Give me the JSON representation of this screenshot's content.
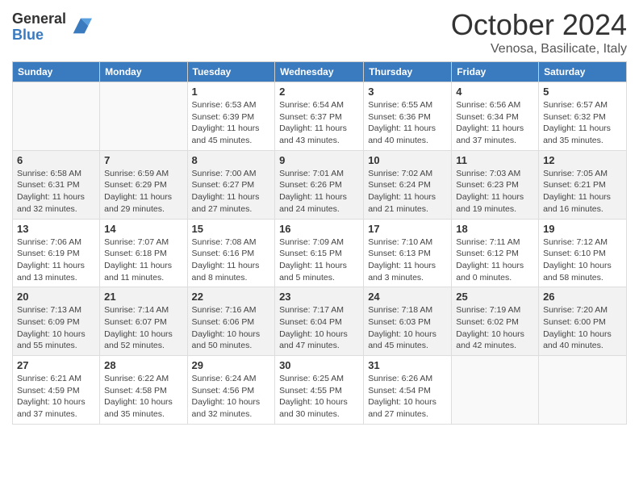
{
  "header": {
    "logo_general": "General",
    "logo_blue": "Blue",
    "title": "October 2024",
    "subtitle": "Venosa, Basilicate, Italy"
  },
  "weekdays": [
    "Sunday",
    "Monday",
    "Tuesday",
    "Wednesday",
    "Thursday",
    "Friday",
    "Saturday"
  ],
  "weeks": [
    [
      {
        "day": "",
        "sunrise": "",
        "sunset": "",
        "daylight": ""
      },
      {
        "day": "",
        "sunrise": "",
        "sunset": "",
        "daylight": ""
      },
      {
        "day": "1",
        "sunrise": "Sunrise: 6:53 AM",
        "sunset": "Sunset: 6:39 PM",
        "daylight": "Daylight: 11 hours and 45 minutes."
      },
      {
        "day": "2",
        "sunrise": "Sunrise: 6:54 AM",
        "sunset": "Sunset: 6:37 PM",
        "daylight": "Daylight: 11 hours and 43 minutes."
      },
      {
        "day": "3",
        "sunrise": "Sunrise: 6:55 AM",
        "sunset": "Sunset: 6:36 PM",
        "daylight": "Daylight: 11 hours and 40 minutes."
      },
      {
        "day": "4",
        "sunrise": "Sunrise: 6:56 AM",
        "sunset": "Sunset: 6:34 PM",
        "daylight": "Daylight: 11 hours and 37 minutes."
      },
      {
        "day": "5",
        "sunrise": "Sunrise: 6:57 AM",
        "sunset": "Sunset: 6:32 PM",
        "daylight": "Daylight: 11 hours and 35 minutes."
      }
    ],
    [
      {
        "day": "6",
        "sunrise": "Sunrise: 6:58 AM",
        "sunset": "Sunset: 6:31 PM",
        "daylight": "Daylight: 11 hours and 32 minutes."
      },
      {
        "day": "7",
        "sunrise": "Sunrise: 6:59 AM",
        "sunset": "Sunset: 6:29 PM",
        "daylight": "Daylight: 11 hours and 29 minutes."
      },
      {
        "day": "8",
        "sunrise": "Sunrise: 7:00 AM",
        "sunset": "Sunset: 6:27 PM",
        "daylight": "Daylight: 11 hours and 27 minutes."
      },
      {
        "day": "9",
        "sunrise": "Sunrise: 7:01 AM",
        "sunset": "Sunset: 6:26 PM",
        "daylight": "Daylight: 11 hours and 24 minutes."
      },
      {
        "day": "10",
        "sunrise": "Sunrise: 7:02 AM",
        "sunset": "Sunset: 6:24 PM",
        "daylight": "Daylight: 11 hours and 21 minutes."
      },
      {
        "day": "11",
        "sunrise": "Sunrise: 7:03 AM",
        "sunset": "Sunset: 6:23 PM",
        "daylight": "Daylight: 11 hours and 19 minutes."
      },
      {
        "day": "12",
        "sunrise": "Sunrise: 7:05 AM",
        "sunset": "Sunset: 6:21 PM",
        "daylight": "Daylight: 11 hours and 16 minutes."
      }
    ],
    [
      {
        "day": "13",
        "sunrise": "Sunrise: 7:06 AM",
        "sunset": "Sunset: 6:19 PM",
        "daylight": "Daylight: 11 hours and 13 minutes."
      },
      {
        "day": "14",
        "sunrise": "Sunrise: 7:07 AM",
        "sunset": "Sunset: 6:18 PM",
        "daylight": "Daylight: 11 hours and 11 minutes."
      },
      {
        "day": "15",
        "sunrise": "Sunrise: 7:08 AM",
        "sunset": "Sunset: 6:16 PM",
        "daylight": "Daylight: 11 hours and 8 minutes."
      },
      {
        "day": "16",
        "sunrise": "Sunrise: 7:09 AM",
        "sunset": "Sunset: 6:15 PM",
        "daylight": "Daylight: 11 hours and 5 minutes."
      },
      {
        "day": "17",
        "sunrise": "Sunrise: 7:10 AM",
        "sunset": "Sunset: 6:13 PM",
        "daylight": "Daylight: 11 hours and 3 minutes."
      },
      {
        "day": "18",
        "sunrise": "Sunrise: 7:11 AM",
        "sunset": "Sunset: 6:12 PM",
        "daylight": "Daylight: 11 hours and 0 minutes."
      },
      {
        "day": "19",
        "sunrise": "Sunrise: 7:12 AM",
        "sunset": "Sunset: 6:10 PM",
        "daylight": "Daylight: 10 hours and 58 minutes."
      }
    ],
    [
      {
        "day": "20",
        "sunrise": "Sunrise: 7:13 AM",
        "sunset": "Sunset: 6:09 PM",
        "daylight": "Daylight: 10 hours and 55 minutes."
      },
      {
        "day": "21",
        "sunrise": "Sunrise: 7:14 AM",
        "sunset": "Sunset: 6:07 PM",
        "daylight": "Daylight: 10 hours and 52 minutes."
      },
      {
        "day": "22",
        "sunrise": "Sunrise: 7:16 AM",
        "sunset": "Sunset: 6:06 PM",
        "daylight": "Daylight: 10 hours and 50 minutes."
      },
      {
        "day": "23",
        "sunrise": "Sunrise: 7:17 AM",
        "sunset": "Sunset: 6:04 PM",
        "daylight": "Daylight: 10 hours and 47 minutes."
      },
      {
        "day": "24",
        "sunrise": "Sunrise: 7:18 AM",
        "sunset": "Sunset: 6:03 PM",
        "daylight": "Daylight: 10 hours and 45 minutes."
      },
      {
        "day": "25",
        "sunrise": "Sunrise: 7:19 AM",
        "sunset": "Sunset: 6:02 PM",
        "daylight": "Daylight: 10 hours and 42 minutes."
      },
      {
        "day": "26",
        "sunrise": "Sunrise: 7:20 AM",
        "sunset": "Sunset: 6:00 PM",
        "daylight": "Daylight: 10 hours and 40 minutes."
      }
    ],
    [
      {
        "day": "27",
        "sunrise": "Sunrise: 6:21 AM",
        "sunset": "Sunset: 4:59 PM",
        "daylight": "Daylight: 10 hours and 37 minutes."
      },
      {
        "day": "28",
        "sunrise": "Sunrise: 6:22 AM",
        "sunset": "Sunset: 4:58 PM",
        "daylight": "Daylight: 10 hours and 35 minutes."
      },
      {
        "day": "29",
        "sunrise": "Sunrise: 6:24 AM",
        "sunset": "Sunset: 4:56 PM",
        "daylight": "Daylight: 10 hours and 32 minutes."
      },
      {
        "day": "30",
        "sunrise": "Sunrise: 6:25 AM",
        "sunset": "Sunset: 4:55 PM",
        "daylight": "Daylight: 10 hours and 30 minutes."
      },
      {
        "day": "31",
        "sunrise": "Sunrise: 6:26 AM",
        "sunset": "Sunset: 4:54 PM",
        "daylight": "Daylight: 10 hours and 27 minutes."
      },
      {
        "day": "",
        "sunrise": "",
        "sunset": "",
        "daylight": ""
      },
      {
        "day": "",
        "sunrise": "",
        "sunset": "",
        "daylight": ""
      }
    ]
  ]
}
